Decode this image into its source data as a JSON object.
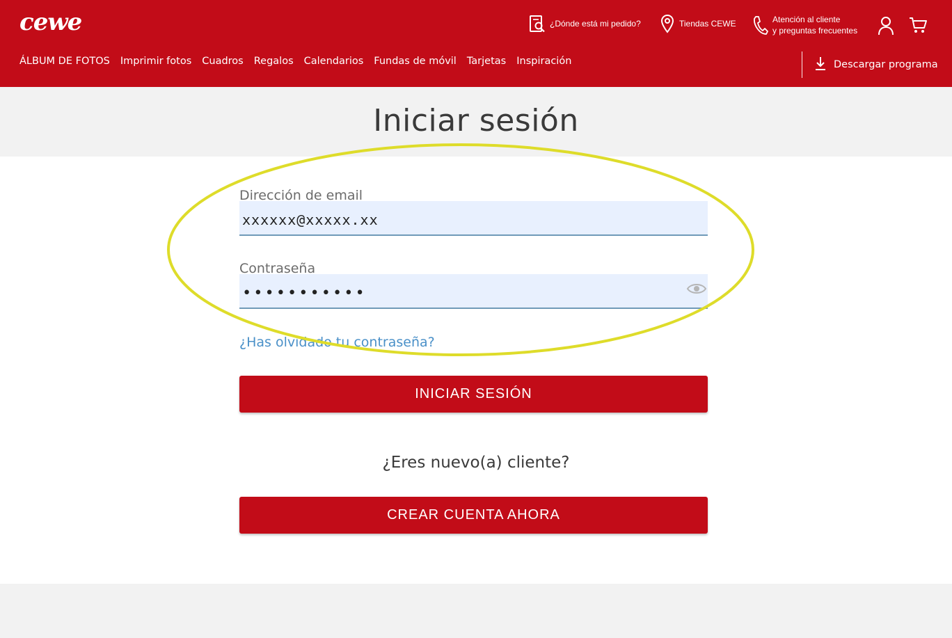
{
  "header": {
    "logo": "cewe",
    "utility": {
      "order_status": "¿Dónde está mi pedido?",
      "stores": "Tiendas CEWE",
      "support_line1": "Atención al cliente",
      "support_line2": "y preguntas frecuentes"
    },
    "nav": [
      "ÁLBUM DE FOTOS",
      "Imprimir fotos",
      "Cuadros",
      "Regalos",
      "Calendarios",
      "Fundas de móvil",
      "Tarjetas",
      "Inspiración"
    ],
    "download": "Descargar programa"
  },
  "page": {
    "title": "Iniciar sesión"
  },
  "form": {
    "email_label": "Dirección de email",
    "email_value": "xxxxxx@xxxxx.xx",
    "password_label": "Contraseña",
    "password_value": "•••••••••••",
    "forgot_link": "¿Has olvidado tu contraseña?",
    "login_button": "INICIAR SESIÓN"
  },
  "register": {
    "prompt": "¿Eres nuevo(a) cliente?",
    "create_button": "CREAR CUENTA AHORA"
  },
  "colors": {
    "brand_red": "#c20c18",
    "input_bg": "#e8f0fe",
    "link_blue": "#4a90c8",
    "highlight_yellow": "#dedc2a"
  },
  "icons": [
    "order-search-icon",
    "location-pin-icon",
    "phone-icon",
    "user-icon",
    "cart-icon",
    "download-icon",
    "eye-icon"
  ]
}
